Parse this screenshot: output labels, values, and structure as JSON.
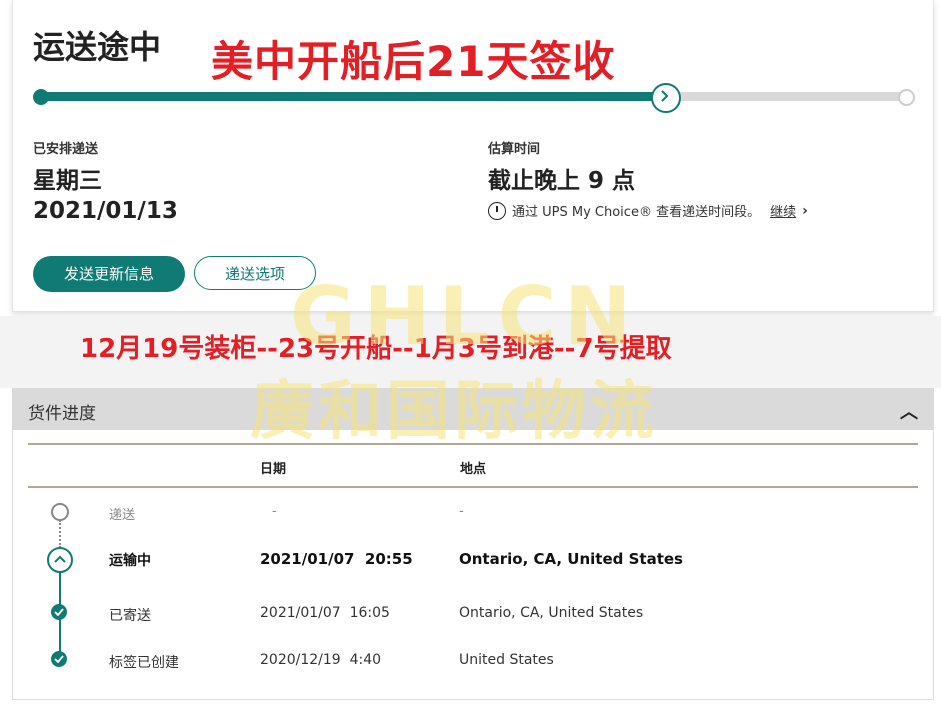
{
  "status": {
    "title": "运送途中",
    "overlay_headline": "美中开船后21天签收",
    "progress": 0.72
  },
  "delivery": {
    "scheduled_label": "已安排递送",
    "day": "星期三",
    "date": "2021/01/13",
    "estimate_label": "估算时间",
    "estimate_value": "截止晚上 9 点",
    "choice_text": "通过 UPS My Choice® 查看递送时间段。",
    "continue_link": "继续"
  },
  "actions": {
    "send_updates": "发送更新信息",
    "delivery_options": "递送选项"
  },
  "overlay_timeline": "12月19号装柜--23号开船--1月3号到港--7号提取",
  "watermark": {
    "latin": "GHLCN",
    "chinese": "廣和国际物流"
  },
  "progress_section": {
    "title": "货件进度",
    "columns": {
      "date": "日期",
      "location": "地点"
    },
    "rows": [
      {
        "status": "递送",
        "date": "-",
        "location": "-",
        "state": "pending"
      },
      {
        "status": "运输中",
        "date": "2021/01/07  20:55",
        "location": "Ontario, CA, United States",
        "state": "current"
      },
      {
        "status": "已寄送",
        "date": "2021/01/07  16:05",
        "location": "Ontario, CA, United States",
        "state": "done"
      },
      {
        "status": "标签已创建",
        "date": "2020/12/19  4:40",
        "location": "United States",
        "state": "done"
      }
    ]
  },
  "colors": {
    "brand_teal": "#107b74",
    "overlay_red": "#e31e24",
    "watermark_yellow": "#f5e178"
  }
}
